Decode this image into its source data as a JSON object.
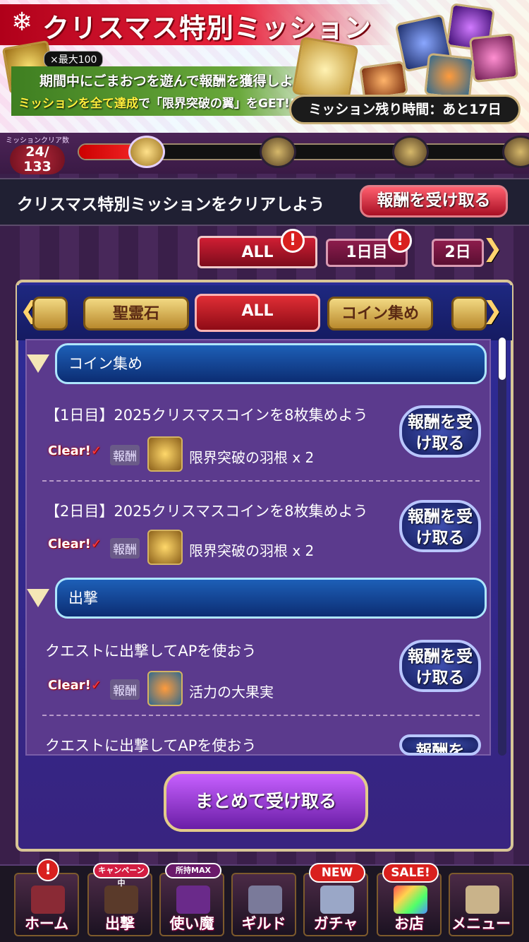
{
  "banner": {
    "title": "クリスマス特別ミッション",
    "multiplier": "×最大100",
    "line1": "期間中にごまおつを遊んで報酬を獲得しよう！",
    "line2_highlight": "ミッションを全て達成",
    "line2_rest": "で「限界突破の翼」をGET!!",
    "remaining": "ミッション残り時間：あと17日"
  },
  "progress": {
    "label": "ミッションクリア数",
    "count": "24/",
    "total": "133",
    "fraction": 0.18
  },
  "header": {
    "title": "クリスマス特別ミッションをクリアしよう",
    "receive_button": "報酬を受け取る"
  },
  "day_tabs": [
    {
      "label": "ALL"
    },
    {
      "label": "1日目"
    },
    {
      "label": "2日"
    }
  ],
  "alert_icon": "!",
  "categories": [
    {
      "label": "聖霊石"
    },
    {
      "label": "ALL"
    },
    {
      "label": "コイン集め"
    }
  ],
  "groups": [
    {
      "name": "コイン集め",
      "missions": [
        {
          "title": "【1日目】2025クリスマスコインを8枚集めよう",
          "status": "Clear!",
          "reward_label": "報酬",
          "reward": "限界突破の羽根 x 2",
          "button": "報酬を受け取る"
        },
        {
          "title": "【2日目】2025クリスマスコインを8枚集めよう",
          "status": "Clear!",
          "reward_label": "報酬",
          "reward": "限界突破の羽根 x 2",
          "button": "報酬を受け取る"
        }
      ]
    },
    {
      "name": "出撃",
      "missions": [
        {
          "title": "クエストに出撃してAPを使おう",
          "status": "Clear!",
          "reward_label": "報酬",
          "reward": "活力の大果実",
          "button": "報酬を受け取る"
        },
        {
          "title": "クエストに出撃してAPを使おう",
          "button": "報酬を"
        }
      ]
    }
  ],
  "batch_button": "まとめて受け取る",
  "nav": [
    {
      "label": "ホーム",
      "badge": "!",
      "icon": "home-icon"
    },
    {
      "label": "出撃",
      "badge": "キャンペーン中",
      "icon": "sortie-icon"
    },
    {
      "label": "使い魔",
      "badge": "所持MAX",
      "icon": "familiar-icon"
    },
    {
      "label": "ギルド",
      "badge": "",
      "icon": "guild-icon"
    },
    {
      "label": "ガチャ",
      "badge": "NEW",
      "icon": "gacha-icon"
    },
    {
      "label": "お店",
      "badge": "SALE!",
      "icon": "shop-icon"
    },
    {
      "label": "メニュー",
      "badge": "",
      "icon": "menu-book-icon"
    }
  ]
}
